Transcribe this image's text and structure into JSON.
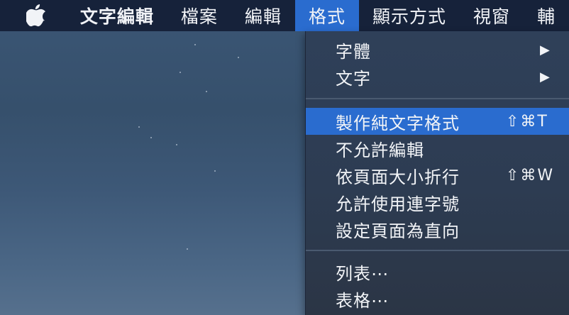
{
  "menubar": {
    "items": [
      {
        "label": "文字編輯"
      },
      {
        "label": "檔案"
      },
      {
        "label": "編輯"
      },
      {
        "label": "格式"
      },
      {
        "label": "顯示方式"
      },
      {
        "label": "視窗"
      },
      {
        "label": "輔"
      }
    ]
  },
  "format_menu": {
    "font_label": "字體",
    "text_label": "文字",
    "make_plain_text_label": "製作純文字格式",
    "make_plain_text_shortcut": "⇧⌘T",
    "prevent_editing_label": "不允許編輯",
    "wrap_to_page_label": "依頁面大小折行",
    "wrap_to_page_shortcut": "⇧⌘W",
    "allow_hyphenation_label": "允許使用連字號",
    "page_vertical_label": "設定頁面為直向",
    "list_label": "列表⋯",
    "table_label": "表格⋯",
    "submenu_arrow": "▶"
  },
  "colors": {
    "menubar_bg": "#16223a",
    "highlight": "#2a6ccf",
    "menu_bg": "#2f4059"
  }
}
